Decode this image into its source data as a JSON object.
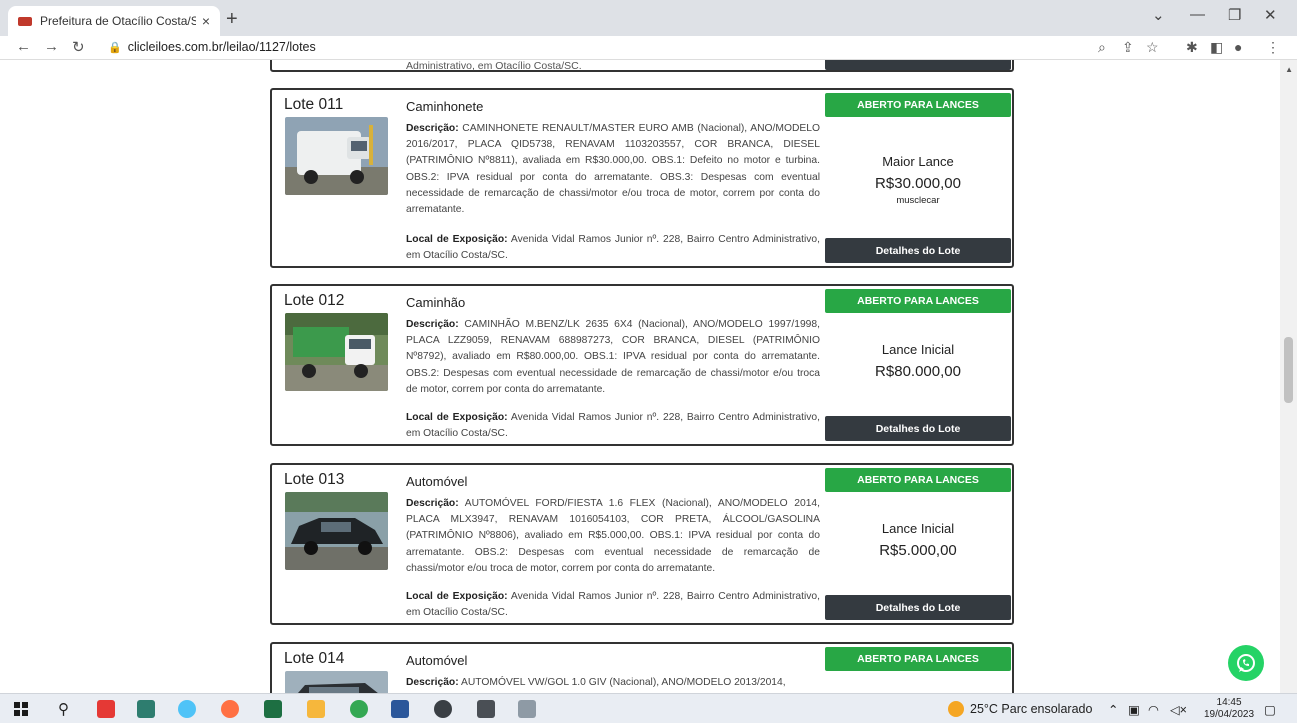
{
  "browser": {
    "tab_title": "Prefeitura de Otacílio Costa/SC :",
    "tab_close": "×",
    "new_tab": "+",
    "url": "clicleiloes.com.br/leilao/1127/lotes"
  },
  "prev_lot_fragment": "Administrativo, em Otacílio Costa/SC.",
  "lots": [
    {
      "number": "Lote 011",
      "category": "Caminhonete",
      "desc_label": "Descrição:",
      "description": "CAMINHONETE RENAULT/MASTER EURO AMB (Nacional), ANO/MODELO 2016/2017, PLACA QID5738, RENAVAM 1103203557, COR BRANCA, DIESEL (PATRIMÔNIO Nº8811), avaliada em R$30.000,00. OBS.1: Defeito no motor e turbina. OBS.2: IPVA residual por conta do arrematante. OBS.3: Despesas com eventual necessidade de remarcação de chassi/motor e/ou troca de motor, correm por conta do arrematante.",
      "location_label": "Local de Exposição:",
      "location": "Avenida Vidal Ramos Junior nº. 228, Bairro Centro Administrativo, em Otacílio Costa/SC.",
      "status": "ABERTO PARA LANCES",
      "bid_label": "Maior Lance",
      "bid_value": "R$30.000,00",
      "bid_user": "musclecar",
      "details": "Detalhes do Lote"
    },
    {
      "number": "Lote 012",
      "category": "Caminhão",
      "desc_label": "Descrição:",
      "description": "CAMINHÃO M.BENZ/LK 2635 6X4 (Nacional), ANO/MODELO 1997/1998, PLACA LZZ9059, RENAVAM 688987273, COR BRANCA, DIESEL (PATRIMÔNIO Nº8792), avaliado em R$80.000,00. OBS.1: IPVA residual por conta do arrematante. OBS.2: Despesas com eventual necessidade de remarcação de chassi/motor e/ou troca de motor, correm por conta do arrematante.",
      "location_label": "Local de Exposição:",
      "location": "Avenida Vidal Ramos Junior nº. 228, Bairro Centro Administrativo, em Otacílio Costa/SC.",
      "status": "ABERTO PARA LANCES",
      "bid_label": "Lance Inicial",
      "bid_value": "R$80.000,00",
      "details": "Detalhes do Lote"
    },
    {
      "number": "Lote 013",
      "category": "Automóvel",
      "desc_label": "Descrição:",
      "description": "AUTOMÓVEL FORD/FIESTA 1.6 FLEX (Nacional), ANO/MODELO 2014, PLACA MLX3947, RENAVAM 1016054103, COR PRETA, ÁLCOOL/GASOLINA (PATRIMÔNIO Nº8806), avaliado em R$5.000,00. OBS.1: IPVA residual por conta do arrematante. OBS.2: Despesas com eventual necessidade de remarcação de chassi/motor e/ou troca de motor, correm por conta do arrematante.",
      "location_label": "Local de Exposição:",
      "location": "Avenida Vidal Ramos Junior nº. 228, Bairro Centro Administrativo, em Otacílio Costa/SC.",
      "status": "ABERTO PARA LANCES",
      "bid_label": "Lance Inicial",
      "bid_value": "R$5.000,00",
      "details": "Detalhes do Lote"
    },
    {
      "number": "Lote 014",
      "category": "Automóvel",
      "desc_label": "Descrição:",
      "description": "AUTOMÓVEL VW/GOL 1.0 GIV (Nacional), ANO/MODELO 2013/2014,",
      "status": "ABERTO PARA LANCES"
    }
  ],
  "taskbar": {
    "weather": "25°C Parc ensolarado",
    "time": "14:45",
    "date": "19/04/2023"
  },
  "colors": {
    "status_green": "#28a745",
    "details_dark": "#343a40",
    "whatsapp": "#25d366"
  }
}
